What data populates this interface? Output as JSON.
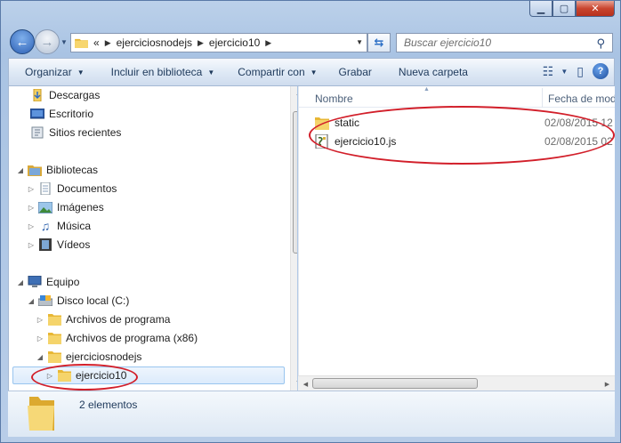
{
  "address": {
    "overflow": "«",
    "crumbs": [
      "ejerciciosnodejs",
      "ejercicio10"
    ]
  },
  "search": {
    "placeholder": "Buscar ejercicio10"
  },
  "toolbar": {
    "organize": "Organizar",
    "include_library": "Incluir en biblioteca",
    "share_with": "Compartir con",
    "burn": "Grabar",
    "new_folder": "Nueva carpeta"
  },
  "nav": {
    "downloads": "Descargas",
    "desktop": "Escritorio",
    "recent": "Sitios recientes",
    "libraries": "Bibliotecas",
    "documents": "Documentos",
    "images": "Imágenes",
    "music": "Música",
    "videos": "Vídeos",
    "computer": "Equipo",
    "local_disk": "Disco local (C:)",
    "program_files": "Archivos de programa",
    "program_files_x86": "Archivos de programa (x86)",
    "ejerciciosnodejs": "ejerciciosnodejs",
    "ejercicio10": "ejercicio10"
  },
  "columns": {
    "name": "Nombre",
    "date": "Fecha de mod"
  },
  "files": [
    {
      "name": "static",
      "date": "02/08/2015 12",
      "icon": "folder-icon"
    },
    {
      "name": "ejercicio10.js",
      "date": "02/08/2015 02",
      "icon": "js-script-icon"
    }
  ],
  "details": {
    "count": "2 elementos"
  },
  "colors": {
    "annotation": "#d21f2a",
    "selection": "#dcebfc",
    "folder": "#f3cf5c"
  }
}
